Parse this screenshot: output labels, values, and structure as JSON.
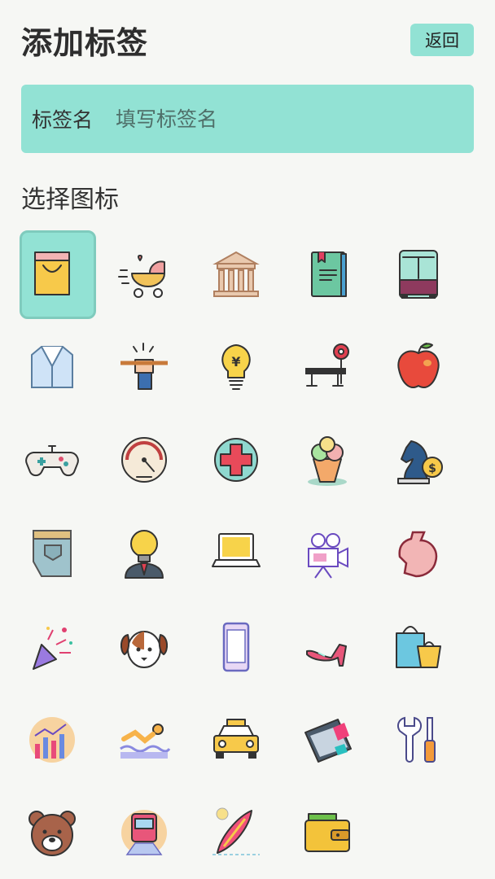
{
  "header": {
    "title": "添加标签",
    "back_label": "返回"
  },
  "tag_name": {
    "label": "标签名",
    "placeholder": "填写标签名",
    "value": ""
  },
  "icons_section": {
    "title": "选择图标"
  },
  "icons": [
    {
      "name": "shopping-bag-icon",
      "selected": true
    },
    {
      "name": "baby-stroller-icon",
      "selected": false
    },
    {
      "name": "bank-icon",
      "selected": false
    },
    {
      "name": "book-icon",
      "selected": false
    },
    {
      "name": "bus-icon",
      "selected": false
    },
    {
      "name": "jacket-icon",
      "selected": false
    },
    {
      "name": "hand-pencil-icon",
      "selected": false
    },
    {
      "name": "yuan-lightbulb-icon",
      "selected": false
    },
    {
      "name": "bench-press-icon",
      "selected": false
    },
    {
      "name": "apple-icon",
      "selected": false
    },
    {
      "name": "gamepad-icon",
      "selected": false
    },
    {
      "name": "gauge-icon",
      "selected": false
    },
    {
      "name": "medical-cross-icon",
      "selected": false
    },
    {
      "name": "ice-cream-icon",
      "selected": false
    },
    {
      "name": "chess-knight-dollar-icon",
      "selected": false
    },
    {
      "name": "jeans-pocket-icon",
      "selected": false
    },
    {
      "name": "idea-man-icon",
      "selected": false
    },
    {
      "name": "laptop-icon",
      "selected": false
    },
    {
      "name": "movie-camera-icon",
      "selected": false
    },
    {
      "name": "muscle-arm-icon",
      "selected": false
    },
    {
      "name": "party-popper-icon",
      "selected": false
    },
    {
      "name": "dog-icon",
      "selected": false
    },
    {
      "name": "phone-icon",
      "selected": false
    },
    {
      "name": "high-heel-icon",
      "selected": false
    },
    {
      "name": "shopping-bags-icon",
      "selected": false
    },
    {
      "name": "chart-icon",
      "selected": false
    },
    {
      "name": "swimming-icon",
      "selected": false
    },
    {
      "name": "taxi-icon",
      "selected": false
    },
    {
      "name": "tickets-icon",
      "selected": false
    },
    {
      "name": "wrench-screwdriver-icon",
      "selected": false
    },
    {
      "name": "bear-icon",
      "selected": false
    },
    {
      "name": "train-icon",
      "selected": false
    },
    {
      "name": "surfboard-icon",
      "selected": false
    },
    {
      "name": "wallet-icon",
      "selected": false
    }
  ],
  "colors": {
    "accent": "#92e2d4",
    "background": "#f6f7f4"
  }
}
